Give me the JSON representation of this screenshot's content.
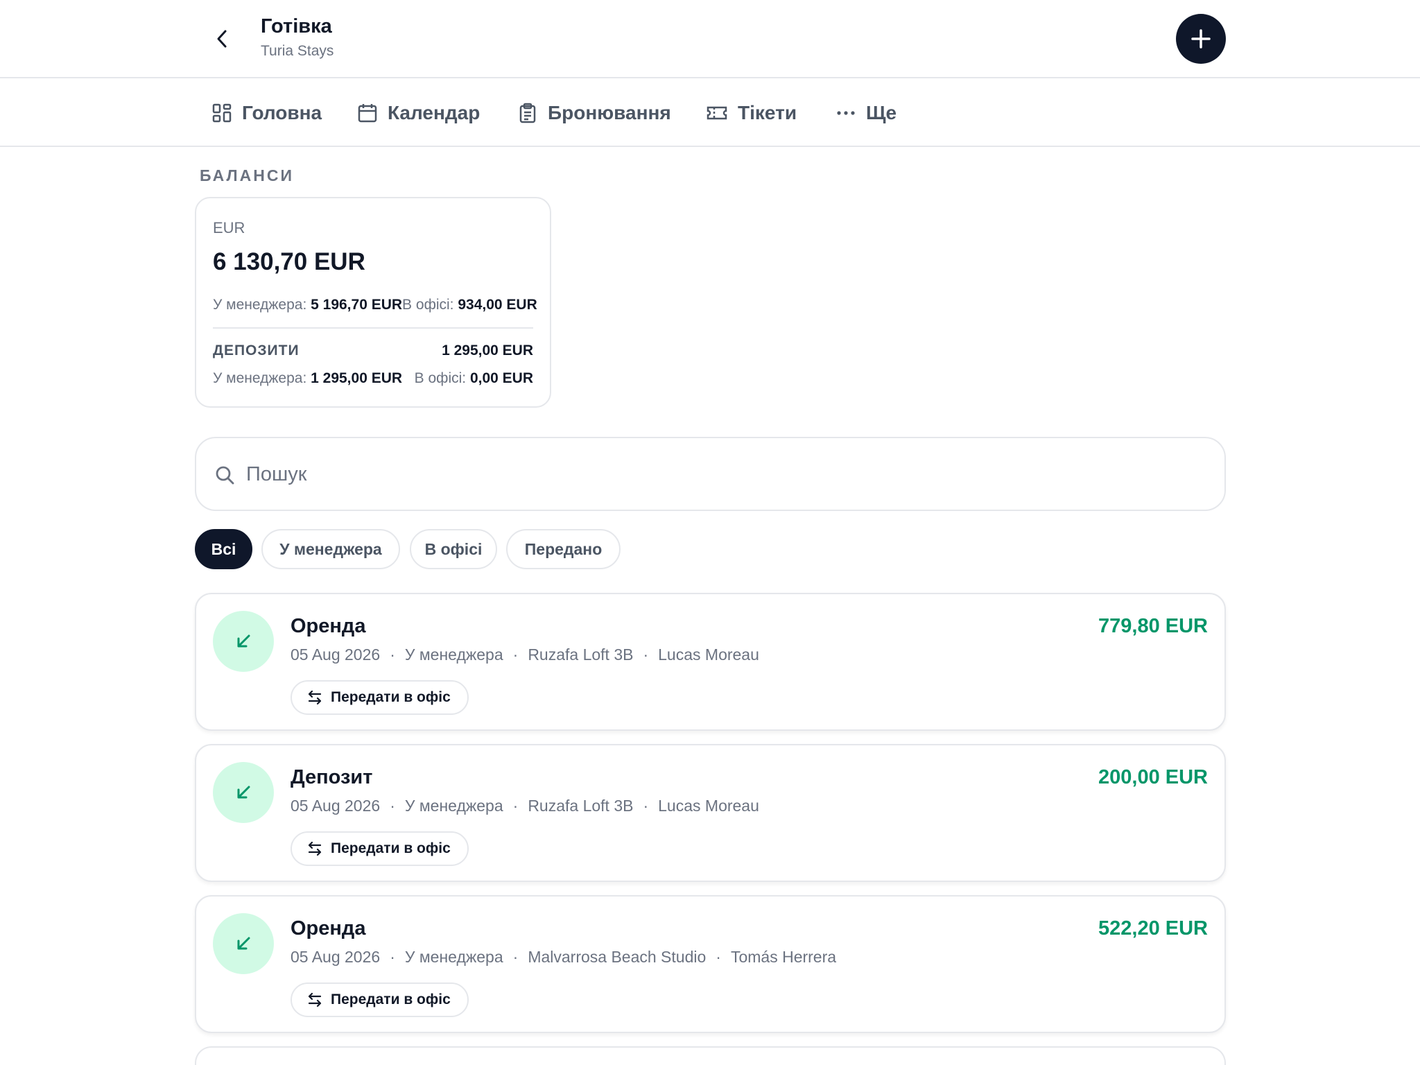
{
  "header": {
    "title": "Готівка",
    "subtitle": "Turia Stays"
  },
  "nav": {
    "items": [
      {
        "label": "Головна",
        "icon": "grid-icon"
      },
      {
        "label": "Календар",
        "icon": "calendar-icon"
      },
      {
        "label": "Бронювання",
        "icon": "clipboard-icon"
      },
      {
        "label": "Тікети",
        "icon": "ticket-icon"
      },
      {
        "label": "Ще",
        "icon": "more-icon"
      }
    ]
  },
  "balances": {
    "section_label": "БАЛАНСИ",
    "currency": "EUR",
    "total": "6 130,70 EUR",
    "manager_label": "У менеджера:",
    "manager_value": "5 196,70 EUR",
    "office_label": "В офісі:",
    "office_value": "934,00 EUR",
    "deposits_label": "ДЕПОЗИТИ",
    "deposits_total": "1 295,00 EUR",
    "deposits_manager_label": "У менеджера:",
    "deposits_manager_value": "1 295,00 EUR",
    "deposits_office_label": "В офісі:",
    "deposits_office_value": "0,00 EUR"
  },
  "search": {
    "placeholder": "Пошук",
    "value": ""
  },
  "filters": {
    "items": [
      "Всі",
      "У менеджера",
      "В офісі",
      "Передано"
    ],
    "active": "Всі"
  },
  "transactions": [
    {
      "title": "Оренда",
      "date": "05 Aug 2026",
      "status": "У менеджера",
      "property": "Ruzafa Loft 3B",
      "guest": "Lucas Moreau",
      "amount": "779,80 EUR",
      "action": "Передати в офіс"
    },
    {
      "title": "Депозит",
      "date": "05 Aug 2026",
      "status": "У менеджера",
      "property": "Ruzafa Loft 3B",
      "guest": "Lucas Moreau",
      "amount": "200,00 EUR",
      "action": "Передати в офіс"
    },
    {
      "title": "Оренда",
      "date": "05 Aug 2026",
      "status": "У менеджера",
      "property": "Malvarrosa Beach Studio",
      "guest": "Tomás Herrera",
      "amount": "522,20 EUR",
      "action": "Передати в офіс"
    }
  ],
  "meta_separator": "·",
  "colors": {
    "accent_dark": "#0f172a",
    "income_green": "#059669",
    "income_bg": "#d1fae5"
  }
}
